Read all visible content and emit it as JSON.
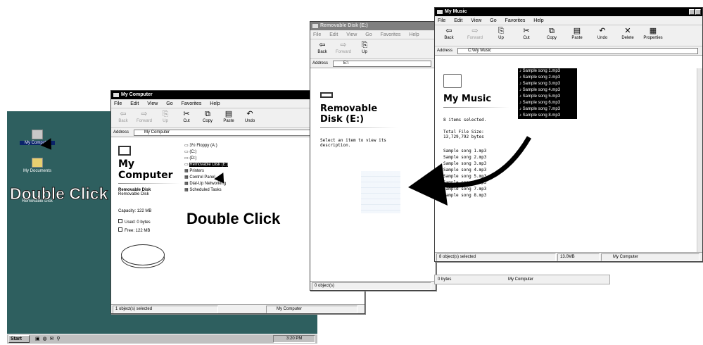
{
  "desktop": {
    "icons": [
      {
        "label": "My Computer",
        "icon": "computer-icon"
      },
      {
        "label": "My Documents",
        "icon": "folder-icon"
      },
      {
        "label": "Removable Disk",
        "icon": "drive-icon"
      }
    ],
    "callout": "Double Click",
    "taskbar": {
      "start": "Start",
      "quick": "",
      "time": "3:20 PM"
    }
  },
  "win_computer": {
    "title": "My Computer",
    "menu": [
      "File",
      "Edit",
      "View",
      "Go",
      "Favorites",
      "Help"
    ],
    "toolbar": [
      "Back",
      "Forward",
      "Up",
      "Cut",
      "Copy",
      "Paste",
      "Undo"
    ],
    "address_label": "Address",
    "address": "My Computer",
    "heading_1": "My",
    "heading_2": "Computer",
    "drive_name": "Removable Disk",
    "drive_type": "Removable Disk",
    "capacity": "Capacity: 122 MB",
    "used": "Used: 0 bytes",
    "free": "Free: 122 MB",
    "items": [
      "3½ Floppy (A:)",
      "(C:)",
      "(D:)",
      "Removable Disk (E:)",
      "Printers",
      "Control Panel",
      "Dial-Up Networking",
      "Scheduled Tasks"
    ],
    "status": "1 object(s) selected",
    "status_zone": "My Computer",
    "callout": "Double Click"
  },
  "win_removable": {
    "title": "Removable Disk (E:)",
    "menu": [
      "File",
      "Edit",
      "View",
      "Go",
      "Favorites",
      "Help"
    ],
    "toolbar": [
      "Back",
      "Forward",
      "Up"
    ],
    "address_label": "Address",
    "address": "E:\\",
    "heading_1": "Removable",
    "heading_2": "Disk (E:)",
    "description": "Select an item to view its description.",
    "status": "0 object(s)",
    "status_size": "0 bytes",
    "status_zone": "My Computer"
  },
  "win_music": {
    "title": "My Music",
    "menu": [
      "File",
      "Edit",
      "View",
      "Go",
      "Favorites",
      "Help"
    ],
    "toolbar": [
      "Back",
      "Forward",
      "Up",
      "Cut",
      "Copy",
      "Paste",
      "Undo",
      "Delete",
      "Properties"
    ],
    "address_label": "Address",
    "address": "C:\\My Music",
    "heading": "My Music",
    "selected_info": "8 items selected.",
    "total_label": "Total File Size:",
    "total_value": "13,729,792 bytes",
    "files": [
      "Sample song 1.mp3",
      "Sample song 2.mp3",
      "Sample song 3.mp3",
      "Sample song 4.mp3",
      "Sample song 5.mp3",
      "Sample song 6.mp3",
      "Sample song 7.mp3",
      "Sample song 8.mp3"
    ],
    "status": "8 object(s) selected",
    "status_size": "13.0MB",
    "status_zone": "My Computer"
  }
}
